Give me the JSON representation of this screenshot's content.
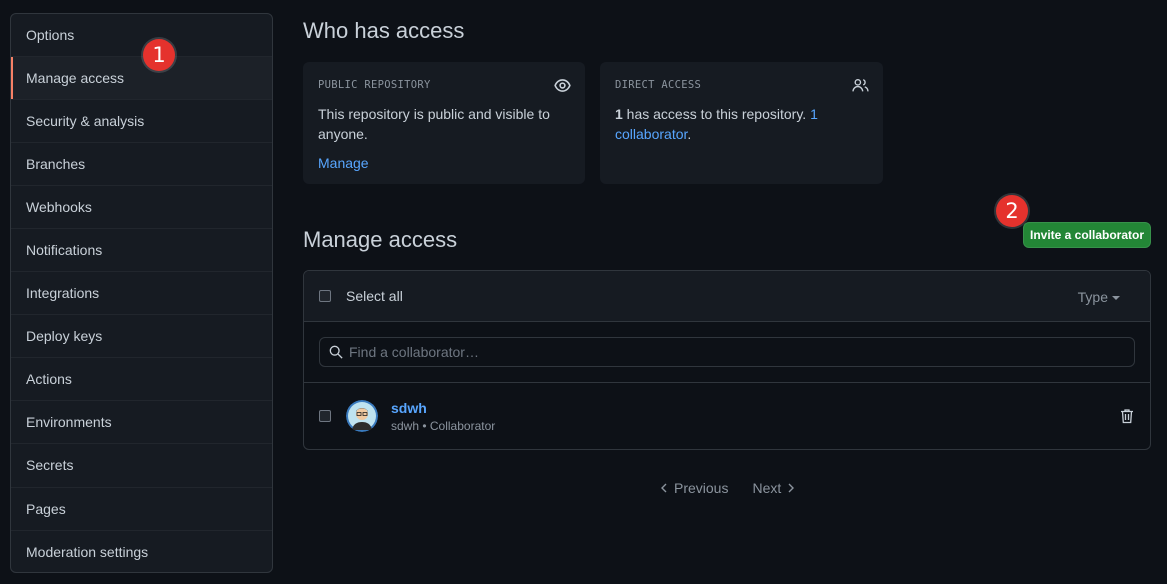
{
  "sidebar": {
    "items": [
      {
        "label": "Options"
      },
      {
        "label": "Manage access"
      },
      {
        "label": "Security & analysis"
      },
      {
        "label": "Branches"
      },
      {
        "label": "Webhooks"
      },
      {
        "label": "Notifications"
      },
      {
        "label": "Integrations"
      },
      {
        "label": "Deploy keys"
      },
      {
        "label": "Actions"
      },
      {
        "label": "Environments"
      },
      {
        "label": "Secrets"
      },
      {
        "label": "Pages"
      },
      {
        "label": "Moderation settings"
      }
    ],
    "active": "Manage access"
  },
  "badges": {
    "one": "1",
    "two": "2"
  },
  "who_has_access": {
    "title": "Who has access",
    "public_card": {
      "label": "PUBLIC REPOSITORY",
      "icon": "eye-icon",
      "text": "This repository is public and visible to anyone.",
      "link": "Manage"
    },
    "direct_card": {
      "label": "DIRECT ACCESS",
      "icon": "people-icon",
      "count": "1",
      "text": " has access to this repository. ",
      "link": "1 collaborator",
      "end": "."
    }
  },
  "manage_access": {
    "title": "Manage access",
    "invite_button": "Invite a collaborator",
    "select_all": "Select all",
    "type_filter": "Type",
    "search_placeholder": "Find a collaborator…",
    "members": [
      {
        "name": "sdwh",
        "subtitle": "sdwh • Collaborator"
      }
    ]
  },
  "pagination": {
    "previous": "Previous",
    "next": "Next"
  },
  "colors": {
    "accent": "#58a6ff",
    "invite": "#238636",
    "badge": "#e5322d",
    "active_marker": "#f78166"
  }
}
